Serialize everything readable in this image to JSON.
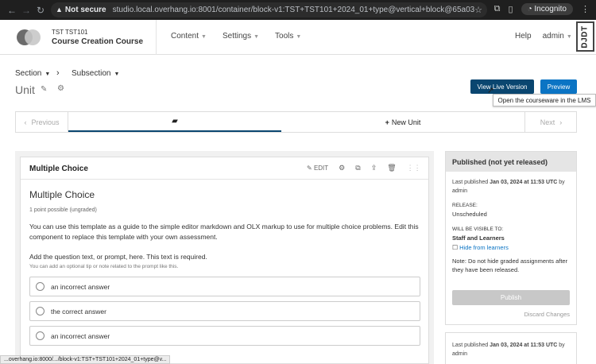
{
  "browser": {
    "security_label": "Not secure",
    "url": "studio.local.overhang.io:8001/container/block-v1:TST+TST101+2024_01+type@vertical+block@65a0359f1ec946ad8ba1bbb7c0...",
    "profile_label": "Incognito",
    "icons": [
      "back-icon",
      "forward-icon",
      "reload-icon",
      "star-icon",
      "extensions-icon",
      "sidebar-icon",
      "incognito-icon",
      "menu-icon"
    ]
  },
  "header": {
    "course_org": "TST TST101",
    "course_name": "Course Creation Course",
    "nav": [
      {
        "label": "Content"
      },
      {
        "label": "Settings"
      },
      {
        "label": "Tools"
      }
    ],
    "help_label": "Help",
    "user_label": "admin",
    "djdt_label": "DJDT"
  },
  "breadcrumb": {
    "section_label": "Section",
    "separator": "›",
    "subsection_label": "Subsection"
  },
  "unit": {
    "title": "Unit"
  },
  "actions": {
    "live_label": "View Live Version",
    "preview_label": "Preview",
    "tooltip": "Open the courseware in the LMS"
  },
  "unit_nav": {
    "previous_label": "Previous",
    "new_unit_label": "New Unit",
    "next_label": "Next"
  },
  "xblock": {
    "header_title": "Multiple Choice",
    "edit_label": "EDIT",
    "problem_title": "Multiple Choice",
    "points": "1 point possible (ungraded)",
    "description": "You can use this template as a guide to the simple editor markdown and OLX markup to use for multiple choice problems. Edit this component to replace this template with your own assessment.",
    "question": "Add the question text, or prompt, here. This text is required.",
    "tip": "You can add an optional tip or note related to the prompt like this.",
    "choices": [
      {
        "label": "an incorrect answer"
      },
      {
        "label": "the correct answer"
      },
      {
        "label": "an incorrect answer"
      }
    ]
  },
  "publish": {
    "status_title": "Published (not yet released)",
    "last_published_prefix": "Last published",
    "last_published_date": "Jan 03, 2024 at 11:53 UTC",
    "by_label": "by",
    "user": "admin",
    "release_label": "RELEASE:",
    "release_value": "Unscheduled",
    "visible_label": "WILL BE VISIBLE TO:",
    "visible_value": "Staff and Learners",
    "hide_label": "Hide from learners",
    "note": "Note: Do not hide graded assignments after they have been released.",
    "publish_label": "Publish",
    "discard_label": "Discard Changes"
  },
  "publish2": {
    "last_published_prefix": "Last published",
    "last_published_date": "Jan 03, 2024 at 11:53 UTC",
    "by_label": "by",
    "user": "admin"
  },
  "status_bar": {
    "url": "...overhang.io:8000/.../block-v1:TST+TST101+2024_01+type@v..."
  },
  "colors": {
    "primary_dark": "#0a4670",
    "primary": "#0b74c4"
  }
}
